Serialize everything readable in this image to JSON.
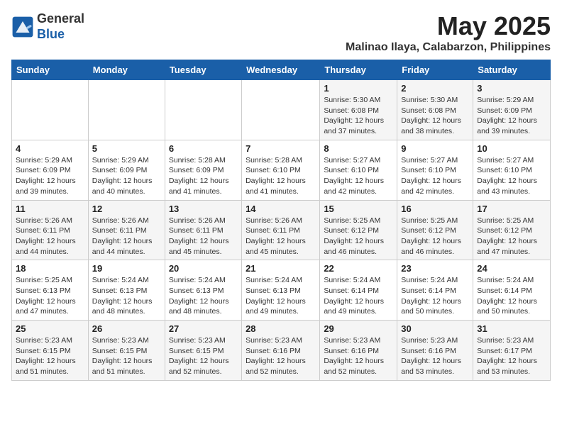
{
  "logo": {
    "general": "General",
    "blue": "Blue"
  },
  "title": "May 2025",
  "location": "Malinao Ilaya, Calabarzon, Philippines",
  "headers": [
    "Sunday",
    "Monday",
    "Tuesday",
    "Wednesday",
    "Thursday",
    "Friday",
    "Saturday"
  ],
  "weeks": [
    [
      {
        "day": "",
        "info": ""
      },
      {
        "day": "",
        "info": ""
      },
      {
        "day": "",
        "info": ""
      },
      {
        "day": "",
        "info": ""
      },
      {
        "day": "1",
        "info": "Sunrise: 5:30 AM\nSunset: 6:08 PM\nDaylight: 12 hours\nand 37 minutes."
      },
      {
        "day": "2",
        "info": "Sunrise: 5:30 AM\nSunset: 6:08 PM\nDaylight: 12 hours\nand 38 minutes."
      },
      {
        "day": "3",
        "info": "Sunrise: 5:29 AM\nSunset: 6:09 PM\nDaylight: 12 hours\nand 39 minutes."
      }
    ],
    [
      {
        "day": "4",
        "info": "Sunrise: 5:29 AM\nSunset: 6:09 PM\nDaylight: 12 hours\nand 39 minutes."
      },
      {
        "day": "5",
        "info": "Sunrise: 5:29 AM\nSunset: 6:09 PM\nDaylight: 12 hours\nand 40 minutes."
      },
      {
        "day": "6",
        "info": "Sunrise: 5:28 AM\nSunset: 6:09 PM\nDaylight: 12 hours\nand 41 minutes."
      },
      {
        "day": "7",
        "info": "Sunrise: 5:28 AM\nSunset: 6:10 PM\nDaylight: 12 hours\nand 41 minutes."
      },
      {
        "day": "8",
        "info": "Sunrise: 5:27 AM\nSunset: 6:10 PM\nDaylight: 12 hours\nand 42 minutes."
      },
      {
        "day": "9",
        "info": "Sunrise: 5:27 AM\nSunset: 6:10 PM\nDaylight: 12 hours\nand 42 minutes."
      },
      {
        "day": "10",
        "info": "Sunrise: 5:27 AM\nSunset: 6:10 PM\nDaylight: 12 hours\nand 43 minutes."
      }
    ],
    [
      {
        "day": "11",
        "info": "Sunrise: 5:26 AM\nSunset: 6:11 PM\nDaylight: 12 hours\nand 44 minutes."
      },
      {
        "day": "12",
        "info": "Sunrise: 5:26 AM\nSunset: 6:11 PM\nDaylight: 12 hours\nand 44 minutes."
      },
      {
        "day": "13",
        "info": "Sunrise: 5:26 AM\nSunset: 6:11 PM\nDaylight: 12 hours\nand 45 minutes."
      },
      {
        "day": "14",
        "info": "Sunrise: 5:26 AM\nSunset: 6:11 PM\nDaylight: 12 hours\nand 45 minutes."
      },
      {
        "day": "15",
        "info": "Sunrise: 5:25 AM\nSunset: 6:12 PM\nDaylight: 12 hours\nand 46 minutes."
      },
      {
        "day": "16",
        "info": "Sunrise: 5:25 AM\nSunset: 6:12 PM\nDaylight: 12 hours\nand 46 minutes."
      },
      {
        "day": "17",
        "info": "Sunrise: 5:25 AM\nSunset: 6:12 PM\nDaylight: 12 hours\nand 47 minutes."
      }
    ],
    [
      {
        "day": "18",
        "info": "Sunrise: 5:25 AM\nSunset: 6:13 PM\nDaylight: 12 hours\nand 47 minutes."
      },
      {
        "day": "19",
        "info": "Sunrise: 5:24 AM\nSunset: 6:13 PM\nDaylight: 12 hours\nand 48 minutes."
      },
      {
        "day": "20",
        "info": "Sunrise: 5:24 AM\nSunset: 6:13 PM\nDaylight: 12 hours\nand 48 minutes."
      },
      {
        "day": "21",
        "info": "Sunrise: 5:24 AM\nSunset: 6:13 PM\nDaylight: 12 hours\nand 49 minutes."
      },
      {
        "day": "22",
        "info": "Sunrise: 5:24 AM\nSunset: 6:14 PM\nDaylight: 12 hours\nand 49 minutes."
      },
      {
        "day": "23",
        "info": "Sunrise: 5:24 AM\nSunset: 6:14 PM\nDaylight: 12 hours\nand 50 minutes."
      },
      {
        "day": "24",
        "info": "Sunrise: 5:24 AM\nSunset: 6:14 PM\nDaylight: 12 hours\nand 50 minutes."
      }
    ],
    [
      {
        "day": "25",
        "info": "Sunrise: 5:23 AM\nSunset: 6:15 PM\nDaylight: 12 hours\nand 51 minutes."
      },
      {
        "day": "26",
        "info": "Sunrise: 5:23 AM\nSunset: 6:15 PM\nDaylight: 12 hours\nand 51 minutes."
      },
      {
        "day": "27",
        "info": "Sunrise: 5:23 AM\nSunset: 6:15 PM\nDaylight: 12 hours\nand 52 minutes."
      },
      {
        "day": "28",
        "info": "Sunrise: 5:23 AM\nSunset: 6:16 PM\nDaylight: 12 hours\nand 52 minutes."
      },
      {
        "day": "29",
        "info": "Sunrise: 5:23 AM\nSunset: 6:16 PM\nDaylight: 12 hours\nand 52 minutes."
      },
      {
        "day": "30",
        "info": "Sunrise: 5:23 AM\nSunset: 6:16 PM\nDaylight: 12 hours\nand 53 minutes."
      },
      {
        "day": "31",
        "info": "Sunrise: 5:23 AM\nSunset: 6:17 PM\nDaylight: 12 hours\nand 53 minutes."
      }
    ]
  ]
}
